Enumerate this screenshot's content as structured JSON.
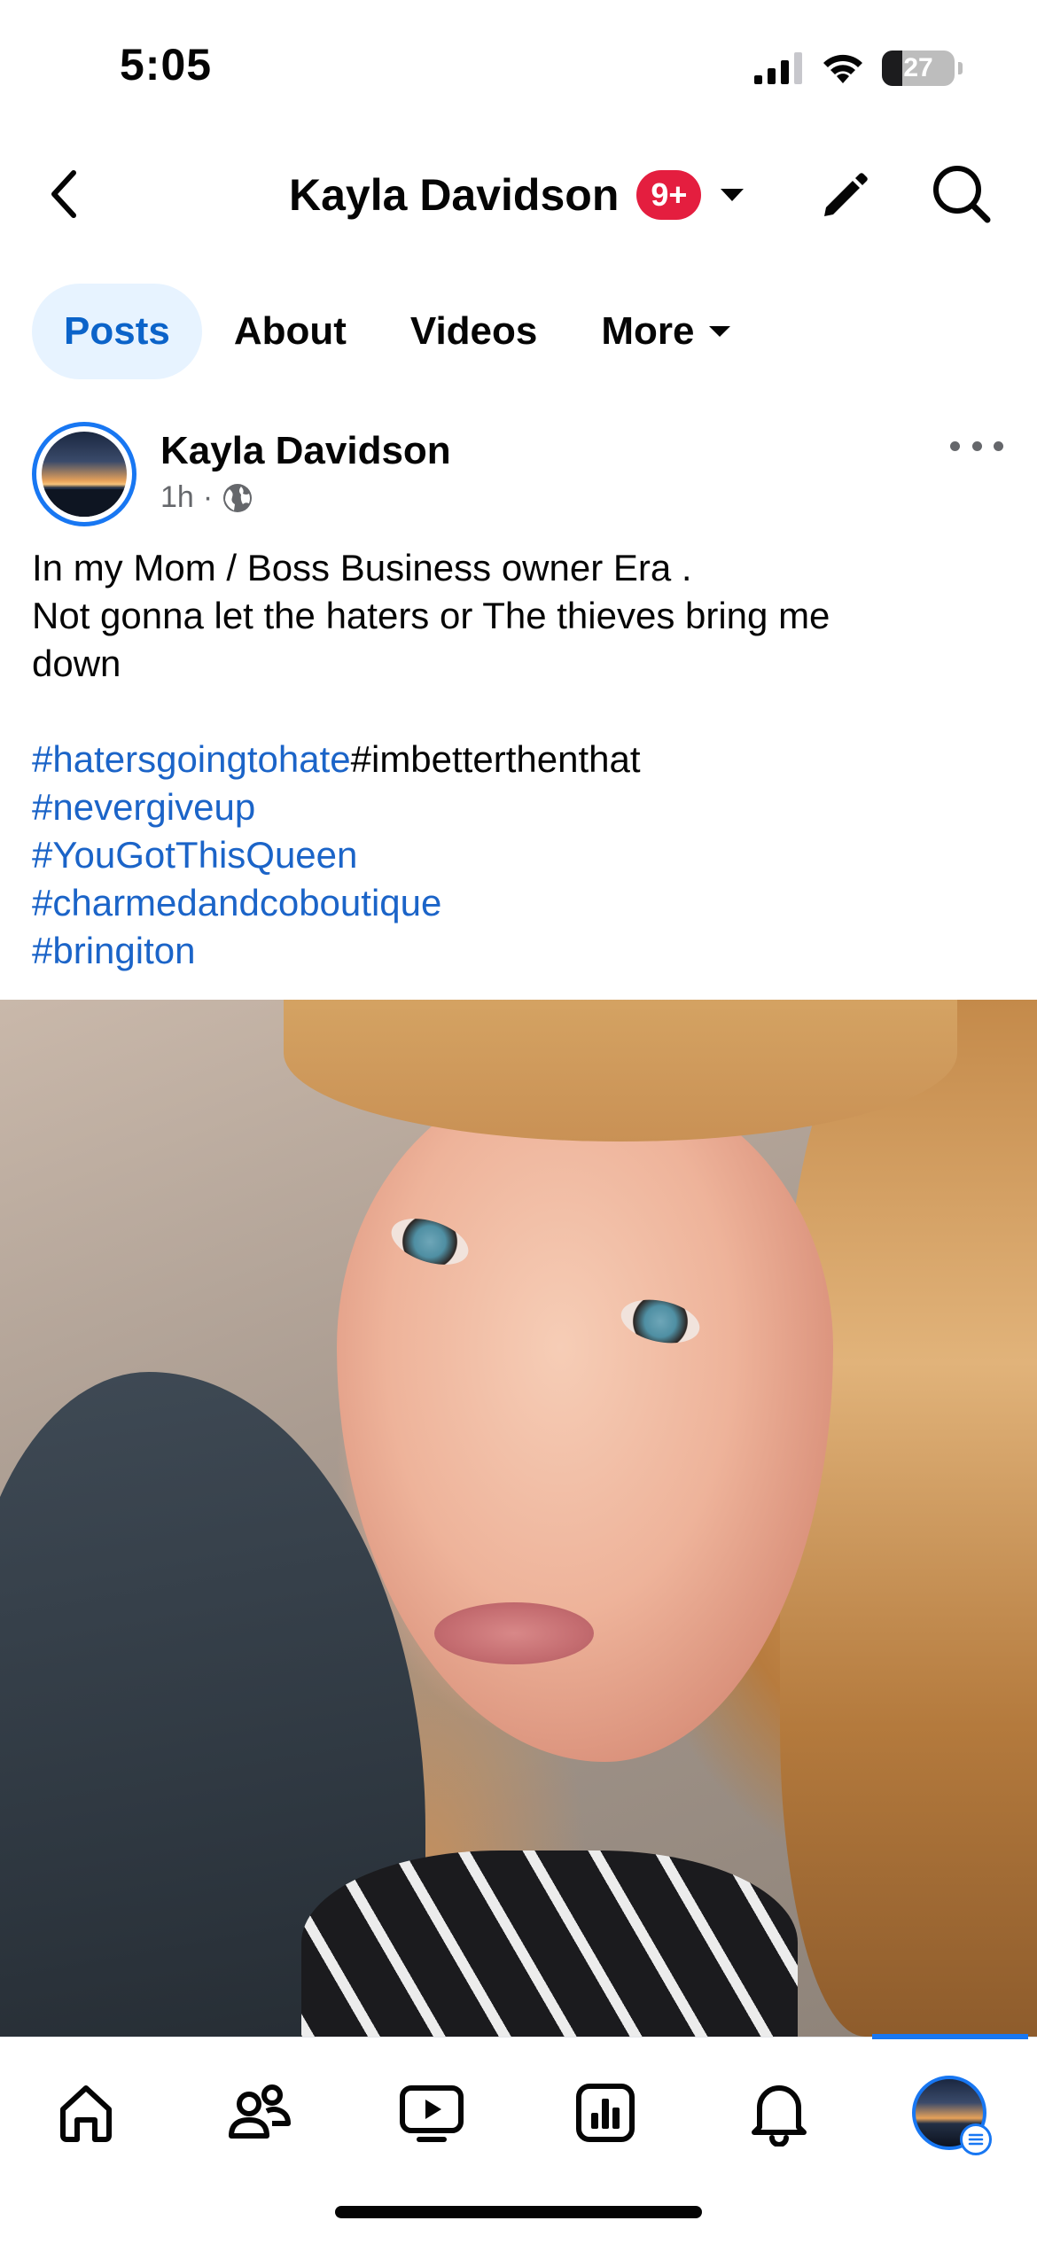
{
  "status_bar": {
    "time": "5:05",
    "battery": "27"
  },
  "header": {
    "title": "Kayla Davidson",
    "badge": "9+"
  },
  "tabs": [
    {
      "label": "Posts",
      "active": true
    },
    {
      "label": "About",
      "active": false
    },
    {
      "label": "Videos",
      "active": false
    },
    {
      "label": "More",
      "active": false
    }
  ],
  "post": {
    "author": "Kayla Davidson",
    "time": "1h",
    "separator": "·",
    "text_lines": [
      "In my Mom / Boss Business owner Era .",
      "Not gonna let the haters or The thieves bring me",
      "down"
    ],
    "hashtag_line_1": {
      "link": "#hatersgoingtohate",
      "plain": "#imbetterthenthat"
    },
    "hashtags": [
      "#nevergiveup",
      "#YouGotThisQueen",
      "#charmedandcoboutique",
      "#bringiton"
    ]
  },
  "icons": {
    "back": "chevron-left-icon",
    "edit": "pencil-icon",
    "search": "search-icon",
    "more": "more-horizontal-icon",
    "privacy": "globe-icon",
    "nav": [
      "home-icon",
      "friends-icon",
      "video-icon",
      "dashboard-icon",
      "bell-icon",
      "profile-menu-icon"
    ]
  },
  "colors": {
    "accent": "#1877f2",
    "hashtag": "#1b64c8",
    "badge": "#e41e3f",
    "active_tab_bg": "#e7f3ff"
  }
}
